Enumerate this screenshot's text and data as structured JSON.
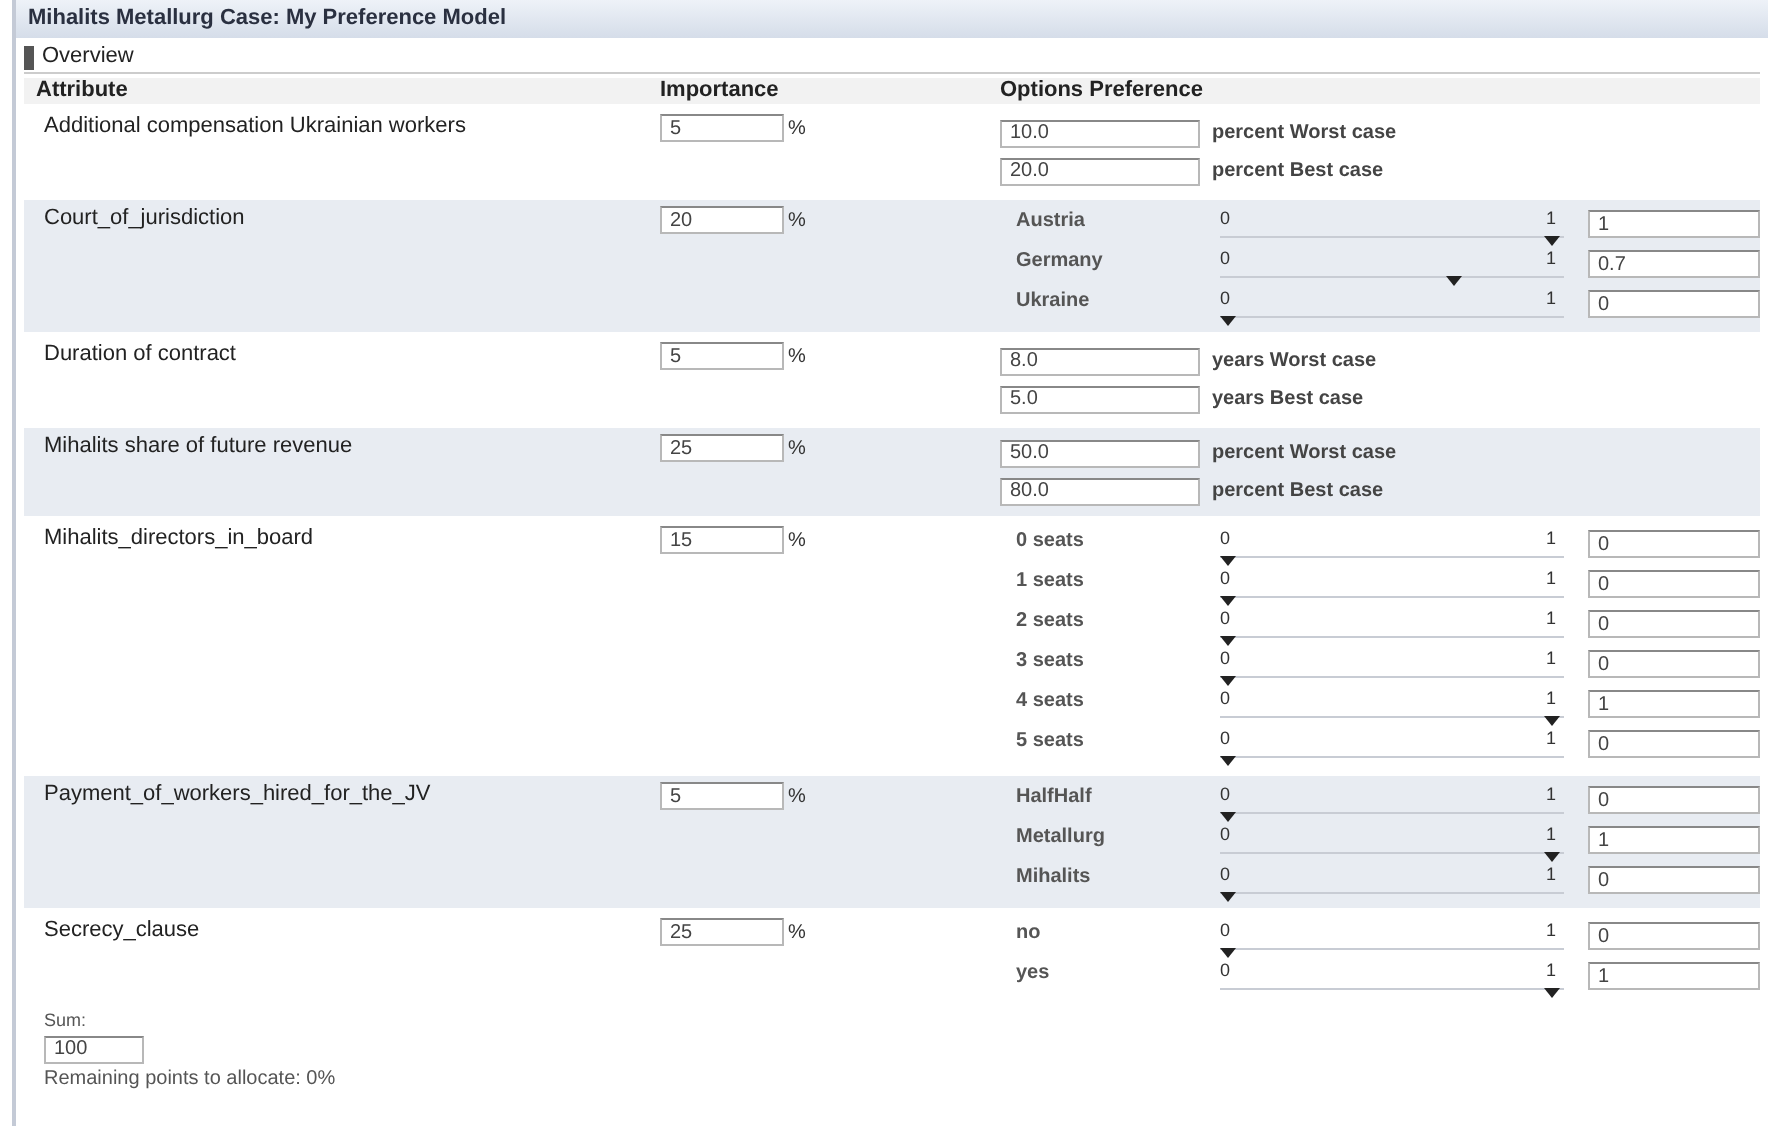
{
  "window": {
    "title": "Mihalits Metallurg Case: My Preference Model"
  },
  "section": {
    "title": "Overview"
  },
  "table": {
    "columns": [
      "Attribute",
      "Importance",
      "Options Preference"
    ],
    "rows": [
      {
        "kind": "range",
        "name": "Additional compensation Ukrainian workers",
        "importance": "5",
        "unit": "%",
        "bounds": [
          {
            "value": "10.0",
            "label": "percent Worst case"
          },
          {
            "value": "20.0",
            "label": "percent Best case"
          }
        ]
      },
      {
        "kind": "discrete",
        "name": "Court_of_jurisdiction",
        "importance": "20",
        "unit": "%",
        "options": [
          {
            "label": "Austria",
            "min": "0",
            "max": "1",
            "level": 1,
            "value": "1"
          },
          {
            "label": "Germany",
            "min": "0",
            "max": "1",
            "level": 0.7,
            "value": "0.7"
          },
          {
            "label": "Ukraine",
            "min": "0",
            "max": "1",
            "level": 0,
            "value": "0"
          }
        ]
      },
      {
        "kind": "range",
        "name": "Duration of contract",
        "importance": "5",
        "unit": "%",
        "bounds": [
          {
            "value": "8.0",
            "label": "years Worst case"
          },
          {
            "value": "5.0",
            "label": "years Best case"
          }
        ]
      },
      {
        "kind": "range",
        "name": "Mihalits share of future revenue",
        "importance": "25",
        "unit": "%",
        "bounds": [
          {
            "value": "50.0",
            "label": "percent Worst case"
          },
          {
            "value": "80.0",
            "label": "percent Best case"
          }
        ]
      },
      {
        "kind": "discrete",
        "name": "Mihalits_directors_in_board",
        "importance": "15",
        "unit": "%",
        "options": [
          {
            "label": "0 seats",
            "min": "0",
            "max": "1",
            "level": 0,
            "value": "0"
          },
          {
            "label": "1 seats",
            "min": "0",
            "max": "1",
            "level": 0,
            "value": "0"
          },
          {
            "label": "2 seats",
            "min": "0",
            "max": "1",
            "level": 0,
            "value": "0"
          },
          {
            "label": "3 seats",
            "min": "0",
            "max": "1",
            "level": 0,
            "value": "0"
          },
          {
            "label": "4 seats",
            "min": "0",
            "max": "1",
            "level": 1,
            "value": "1"
          },
          {
            "label": "5 seats",
            "min": "0",
            "max": "1",
            "level": 0,
            "value": "0"
          }
        ]
      },
      {
        "kind": "discrete",
        "name": "Payment_of_workers_hired_for_the_JV",
        "importance": "5",
        "unit": "%",
        "options": [
          {
            "label": "HalfHalf",
            "min": "0",
            "max": "1",
            "level": 0,
            "value": "0"
          },
          {
            "label": "Metallurg",
            "min": "0",
            "max": "1",
            "level": 1,
            "value": "1"
          },
          {
            "label": "Mihalits",
            "min": "0",
            "max": "1",
            "level": 0,
            "value": "0"
          }
        ]
      },
      {
        "kind": "discrete",
        "name": "Secrecy_clause",
        "importance": "25",
        "unit": "%",
        "options": [
          {
            "label": "no",
            "min": "0",
            "max": "1",
            "level": 0,
            "value": "0"
          },
          {
            "label": "yes",
            "min": "0",
            "max": "1",
            "level": 1,
            "value": "1"
          }
        ]
      }
    ]
  },
  "sum": {
    "label": "Sum:",
    "value": "100",
    "remaining": "Remaining points to allocate: 0%"
  }
}
